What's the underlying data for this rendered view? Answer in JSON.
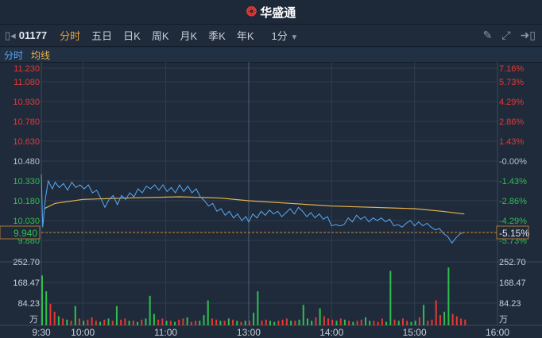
{
  "header": {
    "app_name": "华盛通"
  },
  "toolbar": {
    "code": "01177",
    "tabs": [
      "分时",
      "五日",
      "日K",
      "周K",
      "月K",
      "季K",
      "年K"
    ],
    "active_tab": "分时",
    "interval": "1分"
  },
  "legend": {
    "price": "分时",
    "avg": "均线"
  },
  "colors": {
    "up": "#e53935",
    "down": "#2fbf4f",
    "price_line": "#5aa9f0",
    "avg_line": "#e8b34a",
    "accent": "#e8a33c"
  },
  "chart_data": {
    "type": "line",
    "title": "01177 分时",
    "prev_close": 10.48,
    "current_price": "9.940",
    "current_change": "-5.15%",
    "price_ticks": [
      "11.230",
      "11.080",
      "10.930",
      "10.780",
      "10.630",
      "10.480",
      "10.330",
      "10.180",
      "10.030",
      "9.880"
    ],
    "pct_ticks": [
      "7.16%",
      "5.73%",
      "4.29%",
      "2.86%",
      "1.43%",
      "-0.00%",
      "-1.43%",
      "-2.86%",
      "-4.29%",
      "-5.73%"
    ],
    "ylim": [
      9.83,
      11.23
    ],
    "volume_ticks": [
      "252.70",
      "168.47",
      "84.23"
    ],
    "volume_unit": "万",
    "volume_max": 280,
    "time_ticks": [
      "9:30",
      "10:00",
      "11:00",
      "13:00",
      "14:00",
      "15:00",
      "16:00"
    ],
    "time_tick_minutes": [
      0,
      30,
      90,
      150,
      210,
      270,
      330
    ],
    "price": [
      [
        0,
        10.38
      ],
      [
        1,
        9.98
      ],
      [
        3,
        10.2
      ],
      [
        5,
        10.33
      ],
      [
        8,
        10.27
      ],
      [
        10,
        10.32
      ],
      [
        13,
        10.28
      ],
      [
        16,
        10.31
      ],
      [
        19,
        10.26
      ],
      [
        22,
        10.32
      ],
      [
        25,
        10.28
      ],
      [
        28,
        10.3
      ],
      [
        31,
        10.27
      ],
      [
        34,
        10.3
      ],
      [
        37,
        10.24
      ],
      [
        40,
        10.26
      ],
      [
        43,
        10.2
      ],
      [
        46,
        10.13
      ],
      [
        49,
        10.19
      ],
      [
        52,
        10.22
      ],
      [
        55,
        10.15
      ],
      [
        58,
        10.22
      ],
      [
        61,
        10.19
      ],
      [
        64,
        10.24
      ],
      [
        67,
        10.21
      ],
      [
        70,
        10.27
      ],
      [
        73,
        10.24
      ],
      [
        76,
        10.29
      ],
      [
        79,
        10.27
      ],
      [
        82,
        10.3
      ],
      [
        85,
        10.26
      ],
      [
        88,
        10.3
      ],
      [
        91,
        10.25
      ],
      [
        94,
        10.28
      ],
      [
        97,
        10.24
      ],
      [
        100,
        10.3
      ],
      [
        103,
        10.25
      ],
      [
        106,
        10.29
      ],
      [
        109,
        10.24
      ],
      [
        112,
        10.27
      ],
      [
        115,
        10.21
      ],
      [
        118,
        10.18
      ],
      [
        121,
        10.14
      ],
      [
        124,
        10.16
      ],
      [
        127,
        10.1
      ],
      [
        130,
        10.12
      ],
      [
        133,
        10.07
      ],
      [
        136,
        10.1
      ],
      [
        139,
        10.05
      ],
      [
        142,
        10.08
      ],
      [
        145,
        10.03
      ],
      [
        148,
        10.06
      ],
      [
        150,
        10.02
      ],
      [
        153,
        10.08
      ],
      [
        156,
        10.05
      ],
      [
        159,
        10.1
      ],
      [
        162,
        10.07
      ],
      [
        165,
        10.11
      ],
      [
        168,
        10.08
      ],
      [
        171,
        10.1
      ],
      [
        174,
        10.06
      ],
      [
        177,
        10.09
      ],
      [
        180,
        10.12
      ],
      [
        183,
        10.08
      ],
      [
        186,
        10.13
      ],
      [
        189,
        10.1
      ],
      [
        192,
        10.06
      ],
      [
        195,
        10.09
      ],
      [
        198,
        10.05
      ],
      [
        201,
        10.08
      ],
      [
        204,
        10.04
      ],
      [
        207,
        10.06
      ],
      [
        210,
        9.99
      ],
      [
        213,
        10.0
      ],
      [
        216,
        9.99
      ],
      [
        219,
        10.0
      ],
      [
        222,
        10.05
      ],
      [
        225,
        10.02
      ],
      [
        228,
        10.07
      ],
      [
        231,
        10.04
      ],
      [
        234,
        10.06
      ],
      [
        237,
        10.02
      ],
      [
        240,
        10.05
      ],
      [
        243,
        10.03
      ],
      [
        246,
        10.05
      ],
      [
        249,
        10.02
      ],
      [
        252,
        10.04
      ],
      [
        255,
        9.99
      ],
      [
        258,
        10.0
      ],
      [
        261,
        9.98
      ],
      [
        264,
        10.01
      ],
      [
        267,
        10.03
      ],
      [
        270,
        9.99
      ],
      [
        273,
        10.02
      ],
      [
        276,
        9.99
      ],
      [
        279,
        10.01
      ],
      [
        282,
        9.98
      ],
      [
        285,
        9.96
      ],
      [
        288,
        9.97
      ],
      [
        291,
        9.93
      ],
      [
        294,
        9.91
      ],
      [
        297,
        9.86
      ],
      [
        300,
        9.9
      ],
      [
        303,
        9.93
      ],
      [
        306,
        9.94
      ]
    ],
    "avg": [
      [
        2,
        10.12
      ],
      [
        10,
        10.16
      ],
      [
        30,
        10.19
      ],
      [
        60,
        10.2
      ],
      [
        100,
        10.21
      ],
      [
        130,
        10.2
      ],
      [
        150,
        10.18
      ],
      [
        180,
        10.16
      ],
      [
        210,
        10.14
      ],
      [
        240,
        10.13
      ],
      [
        270,
        10.12
      ],
      [
        290,
        10.1
      ],
      [
        306,
        10.08
      ]
    ],
    "volume": [
      -220,
      -150,
      95,
      60,
      -40,
      30,
      -25,
      20,
      -85,
      30,
      -20,
      25,
      35,
      20,
      -15,
      25,
      -30,
      20,
      -85,
      25,
      30,
      -20,
      20,
      -15,
      25,
      -30,
      -130,
      -50,
      25,
      30,
      -20,
      20,
      -15,
      25,
      30,
      -35,
      15,
      20,
      -20,
      -45,
      -110,
      30,
      25,
      -20,
      20,
      -30,
      25,
      -20,
      15,
      -20,
      20,
      -55,
      -150,
      20,
      25,
      -20,
      -15,
      20,
      25,
      30,
      -20,
      20,
      -25,
      -90,
      -30,
      -20,
      35,
      -75,
      40,
      30,
      25,
      -20,
      30,
      -25,
      20,
      -15,
      20,
      25,
      -35,
      -20,
      20,
      15,
      30,
      -15,
      -240,
      25,
      -20,
      30,
      20,
      -15,
      -20,
      35,
      -90,
      20,
      25,
      110,
      45,
      -60,
      -255,
      50,
      40,
      30,
      25
    ]
  }
}
